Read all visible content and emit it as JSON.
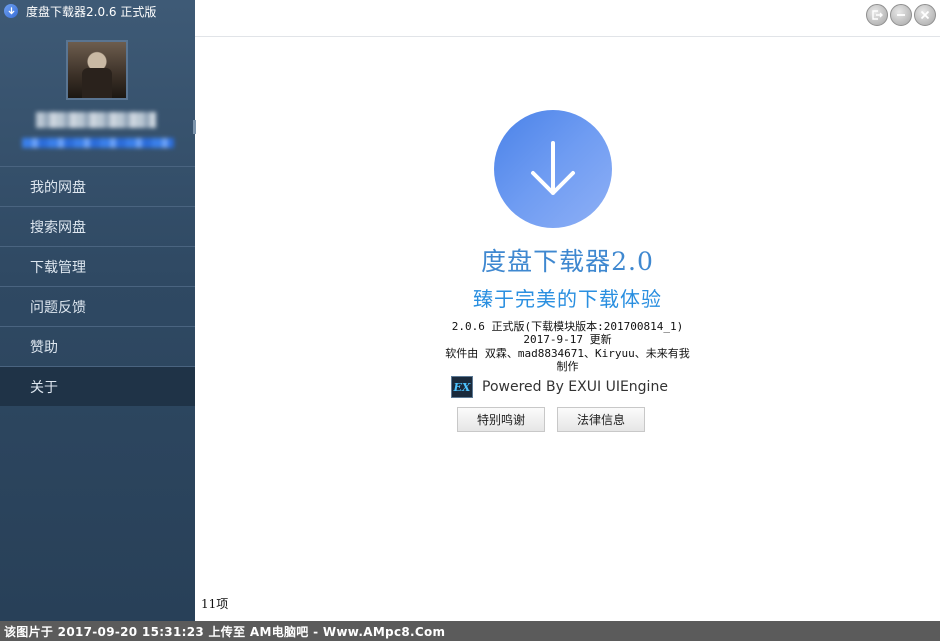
{
  "window": {
    "title": "度盘下载器2.0.6 正式版"
  },
  "sidebar": {
    "items": [
      {
        "label": "我的网盘"
      },
      {
        "label": "搜索网盘"
      },
      {
        "label": "下载管理"
      },
      {
        "label": "问题反馈"
      },
      {
        "label": "赞助"
      },
      {
        "label": "关于"
      }
    ],
    "active_index": 5
  },
  "about": {
    "title": "度盘下载器2.0",
    "slogan": "臻于完美的下载体验",
    "version_line": "2.0.6 正式版(下载模块版本:201700814_1)",
    "date_line": "2017-9-17 更新",
    "credits_line": "软件由 双霖、mad8834671、Kiryuu、未来有我",
    "credits_line2": "制作",
    "powered_by": "Powered By EXUI UIEngine",
    "engine_logo_text": "EX",
    "thanks_button": "特别鸣谢",
    "legal_button": "法律信息"
  },
  "status": {
    "item_count": "11项"
  },
  "watermark": {
    "text": "该图片于 2017-09-20 15:31:23 上传至 AM电脑吧 - Www.AMpc8.Com"
  },
  "colors": {
    "sidebar_bg": "#2f4963",
    "accent_blue": "#3f88d0",
    "logo_blue": "#4a82e8"
  }
}
